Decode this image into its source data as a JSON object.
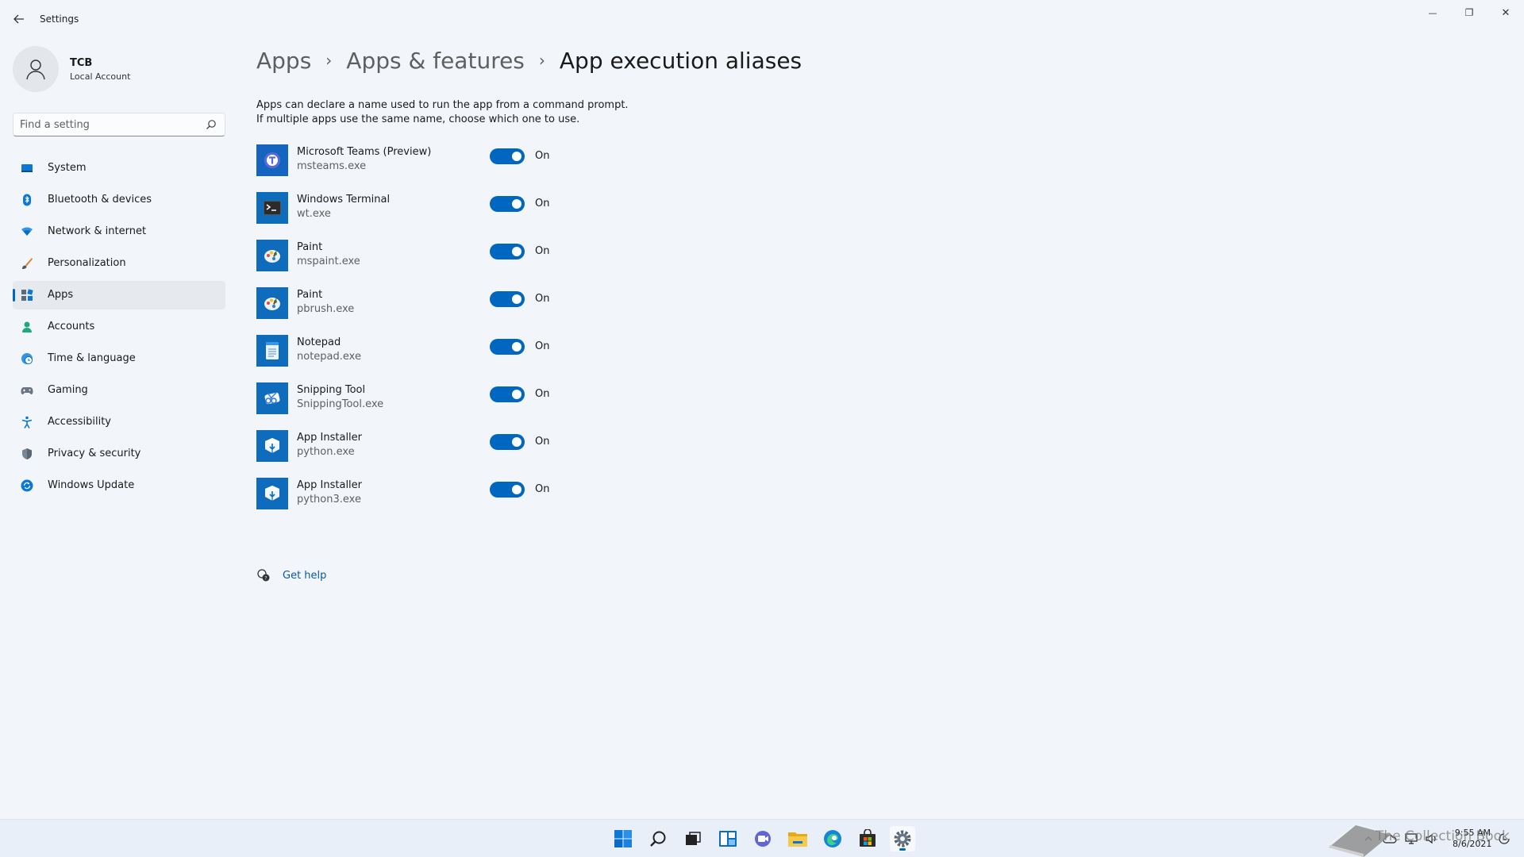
{
  "window": {
    "title": "Settings",
    "controls": {
      "minimize": "—",
      "maximize": "❐",
      "close": "✕"
    }
  },
  "user": {
    "name": "TCB",
    "account_type": "Local Account"
  },
  "search": {
    "placeholder": "Find a setting"
  },
  "sidebar": {
    "items": [
      {
        "label": "System",
        "icon": "system-icon",
        "active": false
      },
      {
        "label": "Bluetooth & devices",
        "icon": "bluetooth-icon",
        "active": false
      },
      {
        "label": "Network & internet",
        "icon": "wifi-icon",
        "active": false
      },
      {
        "label": "Personalization",
        "icon": "brush-icon",
        "active": false
      },
      {
        "label": "Apps",
        "icon": "apps-icon",
        "active": true
      },
      {
        "label": "Accounts",
        "icon": "person-icon",
        "active": false
      },
      {
        "label": "Time & language",
        "icon": "globe-clock-icon",
        "active": false
      },
      {
        "label": "Gaming",
        "icon": "gamepad-icon",
        "active": false
      },
      {
        "label": "Accessibility",
        "icon": "accessibility-icon",
        "active": false
      },
      {
        "label": "Privacy & security",
        "icon": "shield-icon",
        "active": false
      },
      {
        "label": "Windows Update",
        "icon": "update-icon",
        "active": false
      }
    ]
  },
  "breadcrumb": {
    "items": [
      "Apps",
      "Apps & features"
    ],
    "current": "App execution aliases",
    "separator": "›"
  },
  "description": {
    "line1": "Apps can declare a name used to run the app from a command prompt.",
    "line2": "If multiple apps use the same name, choose which one to use."
  },
  "aliases": [
    {
      "name": "Microsoft Teams (Preview)",
      "exe": "msteams.exe",
      "state": "On",
      "icon": "teams-icon"
    },
    {
      "name": "Windows Terminal",
      "exe": "wt.exe",
      "state": "On",
      "icon": "terminal-icon"
    },
    {
      "name": "Paint",
      "exe": "mspaint.exe",
      "state": "On",
      "icon": "paint-icon"
    },
    {
      "name": "Paint",
      "exe": "pbrush.exe",
      "state": "On",
      "icon": "paint-icon"
    },
    {
      "name": "Notepad",
      "exe": "notepad.exe",
      "state": "On",
      "icon": "notepad-icon"
    },
    {
      "name": "Snipping Tool",
      "exe": "SnippingTool.exe",
      "state": "On",
      "icon": "snipping-tool-icon"
    },
    {
      "name": "App Installer",
      "exe": "python.exe",
      "state": "On",
      "icon": "app-installer-icon"
    },
    {
      "name": "App Installer",
      "exe": "python3.exe",
      "state": "On",
      "icon": "app-installer-icon"
    }
  ],
  "help": {
    "label": "Get help"
  },
  "taskbar": {
    "apps": [
      "start-icon",
      "search-icon",
      "task-view-icon",
      "widgets-icon",
      "chat-icon",
      "file-explorer-icon",
      "edge-icon",
      "store-icon",
      "settings-icon"
    ],
    "clock": {
      "time": "9:55 AM",
      "date": "8/6/2021"
    },
    "watermark": "The Collection Book"
  },
  "colors": {
    "accent": "#0067c0",
    "background": "#f2f5fa",
    "link": "#0a58a8"
  }
}
